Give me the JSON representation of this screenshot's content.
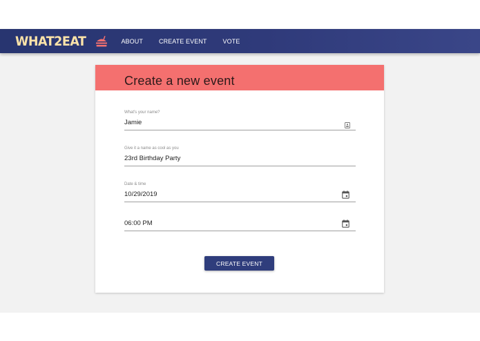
{
  "brand": {
    "name": "WHAT2EAT",
    "icon": "burger-icon",
    "colors": {
      "text": "#fbe3a9",
      "icon": "#f4706f"
    }
  },
  "nav": {
    "items": [
      {
        "label": "ABOUT"
      },
      {
        "label": "CREATE EVENT"
      },
      {
        "label": "VOTE"
      }
    ]
  },
  "form": {
    "title": "Create a new event",
    "fields": [
      {
        "label": "What's your name?",
        "value": "Jamie",
        "icon": "contact-card-icon"
      },
      {
        "label": "Give it a name as cool as you",
        "value": "23rd Birthday Party"
      },
      {
        "label": "Date & time",
        "value": "10/29/2019",
        "icon": "calendar-icon"
      },
      {
        "label": "",
        "value": "06:00 PM",
        "icon": "calendar-icon"
      }
    ],
    "submit_label": "CREATE EVENT"
  },
  "colors": {
    "navbar": "#2f3a7a",
    "header_accent": "#f4706f",
    "button": "#2f3d7c",
    "background": "#f2f2f2"
  }
}
